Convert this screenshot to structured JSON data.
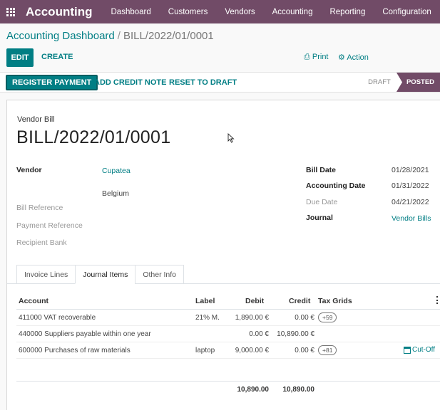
{
  "navbar": {
    "brand": "Accounting",
    "menu": [
      "Dashboard",
      "Customers",
      "Vendors",
      "Accounting",
      "Reporting",
      "Configuration"
    ]
  },
  "breadcrumb": {
    "parent": "Accounting Dashboard",
    "separator": "/",
    "current": "BILL/2022/01/0001"
  },
  "control": {
    "edit": "EDIT",
    "create": "CREATE",
    "print": "Print",
    "action": "Action"
  },
  "statusbar": {
    "register_payment": "REGISTER PAYMENT",
    "add_credit_note": "ADD CREDIT NOTE",
    "reset_to_draft": "RESET TO DRAFT",
    "stages": [
      "DRAFT",
      "POSTED"
    ],
    "active_stage": "POSTED"
  },
  "sheet": {
    "doc_type": "Vendor Bill",
    "doc_name": "BILL/2022/01/0001",
    "left_fields": {
      "vendor_label": "Vendor",
      "vendor_name": "Cupatea",
      "vendor_country": "Belgium",
      "bill_reference_label": "Bill Reference",
      "payment_reference_label": "Payment Reference",
      "recipient_bank_label": "Recipient Bank"
    },
    "right_fields": {
      "bill_date_label": "Bill Date",
      "bill_date": "01/28/2021",
      "accounting_date_label": "Accounting Date",
      "accounting_date": "01/31/2022",
      "due_date_label": "Due Date",
      "due_date": "04/21/2022",
      "journal_label": "Journal",
      "journal": "Vendor Bills"
    },
    "tabs": [
      "Invoice Lines",
      "Journal Items",
      "Other Info"
    ],
    "active_tab": "Journal Items"
  },
  "table": {
    "headers": {
      "account": "Account",
      "label": "Label",
      "debit": "Debit",
      "credit": "Credit",
      "tax_grids": "Tax Grids"
    },
    "rows": [
      {
        "account": "411000 VAT recoverable",
        "label": "21% M.",
        "debit": "1,890.00 €",
        "credit": "0.00 €",
        "tax_grid": "+59",
        "cutoff": ""
      },
      {
        "account": "440000 Suppliers payable within one year",
        "label": "",
        "debit": "0.00 €",
        "credit": "10,890.00 €",
        "tax_grid": "",
        "cutoff": ""
      },
      {
        "account": "600000 Purchases of raw materials",
        "label": "laptop",
        "debit": "9,000.00 €",
        "credit": "0.00 €",
        "tax_grid": "+81",
        "cutoff": "Cut-Off"
      }
    ],
    "totals": {
      "debit": "10,890.00",
      "credit": "10,890.00"
    }
  },
  "colors": {
    "brand": "#714b67",
    "accent": "#017e84"
  }
}
